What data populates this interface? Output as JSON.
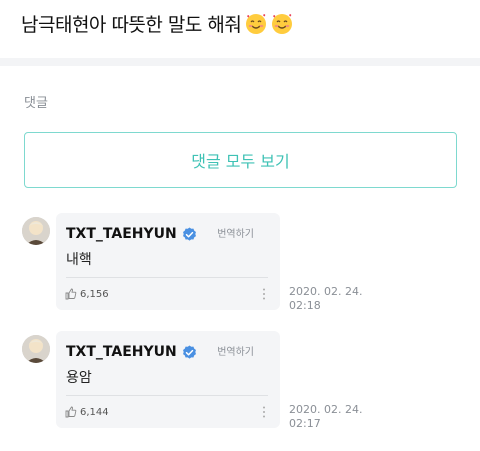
{
  "post": {
    "title": "남극태현아 따뜻한 말도 해줘"
  },
  "comments_section": {
    "label": "댓글",
    "view_all_label": "댓글 모두 보기"
  },
  "comments": [
    {
      "author": "TXT_TAEHYUN",
      "translate_label": "번역하기",
      "text": "내핵",
      "likes": "6,156",
      "date": "2020. 02. 24.",
      "time": "02:18"
    },
    {
      "author": "TXT_TAEHYUN",
      "translate_label": "번역하기",
      "text": "용암",
      "likes": "6,144",
      "date": "2020. 02. 24.",
      "time": "02:17"
    }
  ],
  "colors": {
    "accent": "#3fc2b5",
    "border_accent": "#7ed9cf",
    "verified": "#4a90e2",
    "bubble_bg": "#f4f5f7"
  },
  "icons": [
    "smiling-face-with-hearts-icon",
    "verified-badge-icon",
    "thumbs-up-icon",
    "more-vertical-icon"
  ]
}
